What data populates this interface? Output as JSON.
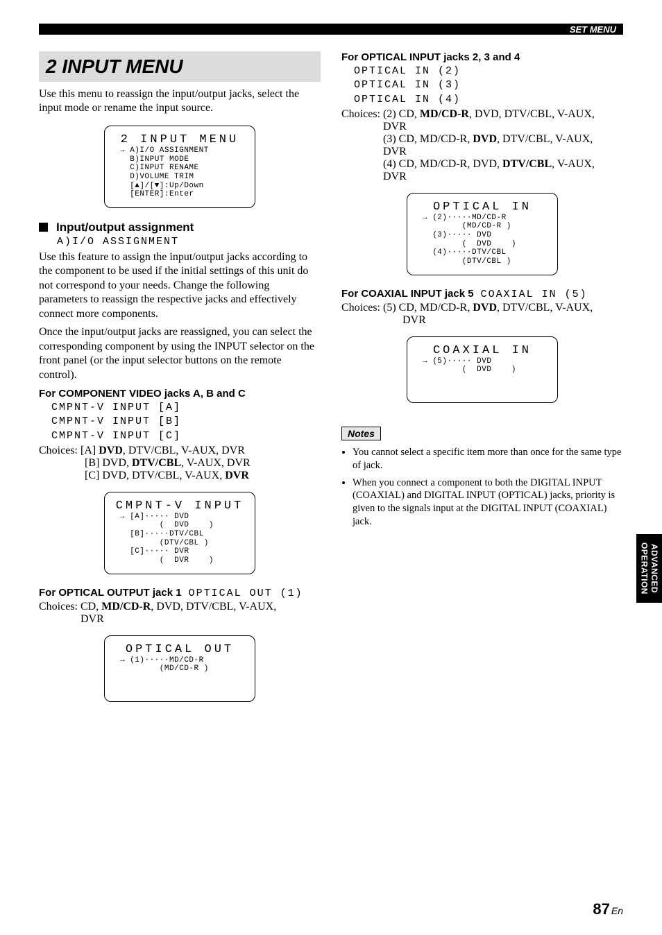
{
  "header": {
    "section": "SET MENU"
  },
  "title": "2 INPUT MENU",
  "intro": "Use this menu to reassign the input/output jacks, select the input mode or rename the input source.",
  "panel1": {
    "title": "2 INPUT MENU",
    "lines": [
      "→ A)I/O ASSIGNMENT",
      "  B)INPUT MODE",
      "  C)INPUT RENAME",
      "  D)VOLUME TRIM",
      "  [▲]/[▼]:Up/Down",
      "  [ENTER]:Enter"
    ]
  },
  "io_heading": "Input/output assignment",
  "io_lcd": "A)I/O ASSIGNMENT",
  "io_para1": "Use this feature to assign the input/output jacks according to the component to be used if the initial settings of this unit do not correspond to your needs. Change the following parameters to reassign the respective jacks and effectively connect more components.",
  "io_para2": "Once the input/output jacks are reassigned, you can select the corresponding component by using the INPUT selector on the front panel (or the input selector buttons on the remote control).",
  "component": {
    "heading": "For COMPONENT VIDEO jacks A, B and C",
    "lines": [
      "CMPNT-V INPUT [A]",
      "CMPNT-V INPUT [B]",
      "CMPNT-V INPUT [C]"
    ],
    "choices_label": "Choices:",
    "choice_a_pre": "[A] ",
    "choice_a_bold": "DVD",
    "choice_a_post": ", DTV/CBL, V-AUX, DVR",
    "choice_b_pre": "[B] DVD, ",
    "choice_b_bold": "DTV/CBL",
    "choice_b_post": ", V-AUX, DVR",
    "choice_c_pre": "[C] DVD, DTV/CBL, V-AUX, ",
    "choice_c_bold": "DVR",
    "panel_title": "CMPNT-V INPUT",
    "panel_lines": [
      "→ [A]····· DVD",
      "        (  DVD    )",
      "  [B]·····DTV/CBL",
      "        (DTV/CBL )",
      "  [C]····· DVR",
      "        (  DVR    )"
    ]
  },
  "optical_out": {
    "heading": "For OPTICAL OUTPUT jack 1",
    "heading_lcd": "OPTICAL OUT (1)",
    "choices_pre": "Choices: CD, ",
    "choices_bold": "MD/CD-R",
    "choices_post": ", DVD, DTV/CBL, V-AUX,",
    "choices_line2": "DVR",
    "panel_title": "OPTICAL OUT",
    "panel_lines": [
      "→ (1)·····MD/CD-R",
      "        (MD/CD-R )"
    ]
  },
  "optical_in": {
    "heading": "For OPTICAL INPUT jacks 2, 3 and 4",
    "lines": [
      "OPTICAL IN (2)",
      "OPTICAL IN (3)",
      "OPTICAL IN (4)"
    ],
    "choices_label": "Choices:",
    "c2_pre": "(2) CD, ",
    "c2_bold": "MD/CD-R",
    "c2_post": ", DVD, DTV/CBL, V-AUX,",
    "c2_line2": "DVR",
    "c3_pre": "(3) CD, MD/CD-R, ",
    "c3_bold": "DVD",
    "c3_post": ", DTV/CBL, V-AUX,",
    "c3_line2": "DVR",
    "c4_pre": "(4) CD, MD/CD-R, DVD, ",
    "c4_bold": "DTV/CBL",
    "c4_post": ", V-AUX,",
    "c4_line2": "DVR",
    "panel_title": "OPTICAL IN",
    "panel_lines": [
      "→ (2)·····MD/CD-R",
      "        (MD/CD-R )",
      "  (3)····· DVD",
      "        (  DVD    )",
      "  (4)·····DTV/CBL",
      "        (DTV/CBL )"
    ]
  },
  "coaxial": {
    "heading": "For COAXIAL INPUT jack 5",
    "heading_lcd": "COAXIAL IN (5)",
    "choices_pre": "Choices: (5) CD, MD/CD-R, ",
    "choices_bold": "DVD",
    "choices_post": ", DTV/CBL, V-AUX,",
    "choices_line2": "DVR",
    "panel_title": "COAXIAL IN",
    "panel_lines": [
      "→ (5)····· DVD",
      "        (  DVD    )"
    ]
  },
  "notes_label": "Notes",
  "notes": [
    "You cannot select a specific item more than once for the same type of jack.",
    "When you connect a component to both the DIGITAL INPUT (COAXIAL) and DIGITAL INPUT (OPTICAL) jacks, priority is given to the signals input at the DIGITAL INPUT (COAXIAL) jack."
  ],
  "sidetab": {
    "line1": "ADVANCED",
    "line2": "OPERATION"
  },
  "page": {
    "num": "87",
    "suffix": "En"
  }
}
